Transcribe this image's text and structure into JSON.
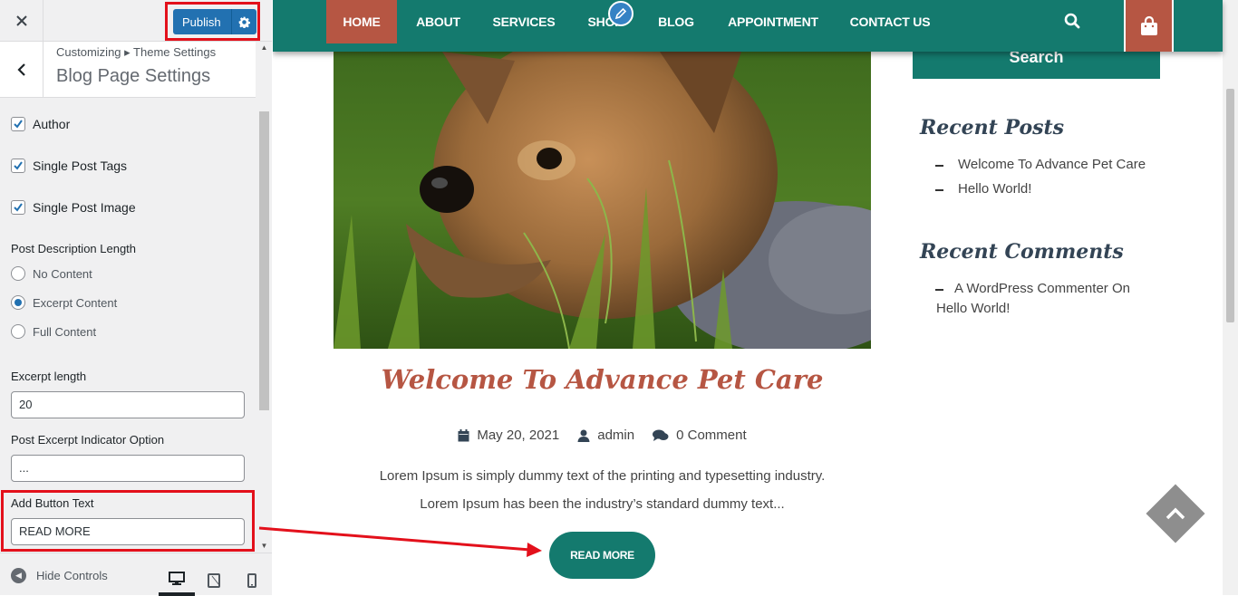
{
  "customizer": {
    "publish_label": "Publish",
    "breadcrumb": "Customizing ▸ Theme Settings",
    "section_title": "Blog Page Settings",
    "checkboxes": [
      {
        "label": "Author",
        "checked": true
      },
      {
        "label": "Single Post Tags",
        "checked": true
      },
      {
        "label": "Single Post Image",
        "checked": true
      }
    ],
    "description_length": {
      "label": "Post Description Length",
      "options": [
        {
          "label": "No Content",
          "selected": false
        },
        {
          "label": "Excerpt Content",
          "selected": true
        },
        {
          "label": "Full Content",
          "selected": false
        }
      ]
    },
    "excerpt_length": {
      "label": "Excerpt length",
      "value": "20"
    },
    "excerpt_indicator": {
      "label": "Post Excerpt Indicator Option",
      "value": "..."
    },
    "button_text": {
      "label": "Add Button Text",
      "value": "READ MORE"
    },
    "hide_controls_label": "Hide Controls",
    "devices": [
      "desktop-icon",
      "tablet-icon",
      "mobile-icon"
    ]
  },
  "nav": {
    "items": [
      "HOME",
      "ABOUT",
      "SERVICES",
      "SHOP",
      "BLOG",
      "APPOINTMENT",
      "CONTACT US"
    ],
    "active": "HOME"
  },
  "post": {
    "title": "Welcome To Advance Pet Care",
    "date": "May 20, 2021",
    "author": "admin",
    "comments": "0 Comment",
    "excerpt_line1": "Lorem Ipsum is simply dummy text of the printing and typesetting industry.",
    "excerpt_line2": "Lorem Ipsum has been the industry’s standard dummy text...",
    "read_more": "READ MORE"
  },
  "sidebar_widgets": {
    "search_button": "Search",
    "recent_posts_title": "Recent Posts",
    "recent_posts": [
      "Welcome To Advance Pet Care",
      "Hello World!"
    ],
    "recent_comments_title": "Recent Comments",
    "recent_comment_line1": "A WordPress Commenter On",
    "recent_comment_line2": "Hello World!"
  },
  "colors": {
    "accent_green": "#147a6e",
    "accent_rust": "#b65643",
    "wp_blue": "#2271b1",
    "highlight_red": "#e3101b"
  }
}
